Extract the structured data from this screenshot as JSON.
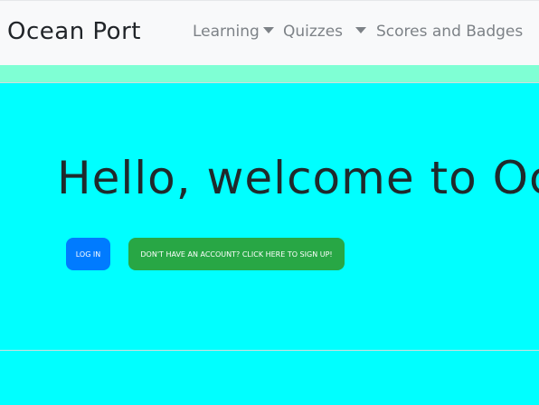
{
  "navbar": {
    "brand": "Ocean Port",
    "items": [
      {
        "label": "Learning",
        "has_dropdown": true
      },
      {
        "label": "Quizzes",
        "has_dropdown": true
      },
      {
        "label": "Scores and Badges",
        "has_dropdown": false
      }
    ]
  },
  "hero": {
    "heading": "Hello, welcome to Oce",
    "login_button": "Log In",
    "signup_button": "Don't have an account? Click here to sign up!"
  },
  "colors": {
    "page_background": "#00ffff",
    "strip": "#7fffd4",
    "navbar": "#f8f9fa",
    "login_button": "#007bff",
    "signup_button": "#28a745"
  },
  "icons": {
    "dropdown": "chevron-down-icon"
  }
}
